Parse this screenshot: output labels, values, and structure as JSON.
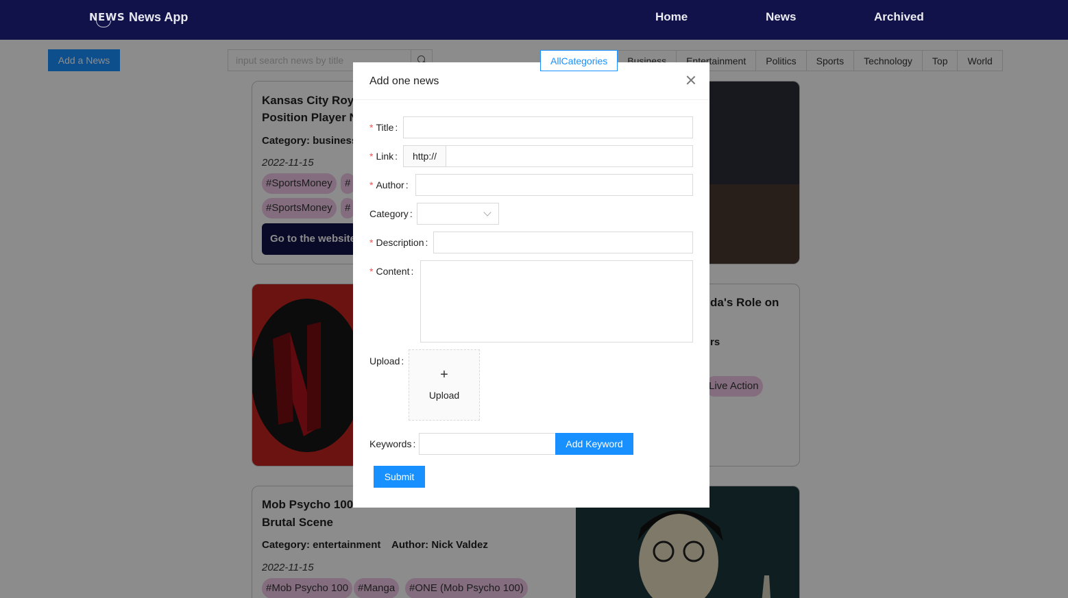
{
  "header": {
    "logo_text": "NEWS",
    "app_name": "News App",
    "nav": [
      "Home",
      "News",
      "Archived"
    ]
  },
  "toolbar": {
    "add_news_label": "Add a News",
    "search_placeholder": "input search news by title",
    "categories": [
      "AllCategories",
      "Business",
      "Entertainment",
      "Politics",
      "Sports",
      "Technology",
      "Top",
      "World"
    ],
    "active_category": "AllCategories"
  },
  "cards": [
    {
      "title_line1": "Kansas City Roy",
      "title_line2": "Position Player N",
      "category": "Category: business",
      "date": "2022-11-15",
      "tags_row1": [
        "#SportsMoney",
        "#"
      ],
      "tags_row2": [
        "#SportsMoney",
        "#"
      ],
      "button": "Go to the website"
    },
    {
      "title_fragment": "da's Role on",
      "meta_fragment": "rs",
      "tag_fragment": "Live Action"
    },
    {
      "title_line1": "Mob Psycho 100",
      "title_line2": "Brutal Scene",
      "category": "Category: entertainment",
      "author": "Author: Nick Valdez",
      "date": "2022-11-15",
      "tags": [
        "#Mob Psycho 100",
        "#Manga",
        "#ONE (Mob Psycho 100)"
      ]
    }
  ],
  "modal": {
    "title": "Add one news",
    "fields": {
      "title_label": "Title",
      "link_label": "Link",
      "link_prefix": "http://",
      "author_label": "Author",
      "category_label": "Category",
      "description_label": "Description",
      "content_label": "Content",
      "upload_label": "Upload",
      "upload_button": "Upload",
      "keywords_label": "Keywords",
      "add_keyword_button": "Add Keyword"
    },
    "submit_label": "Submit"
  },
  "colors": {
    "header_bg": "#11124a",
    "primary": "#1890ff",
    "tag_bg": "#f0c6e8",
    "required": "#ff4d4f"
  }
}
